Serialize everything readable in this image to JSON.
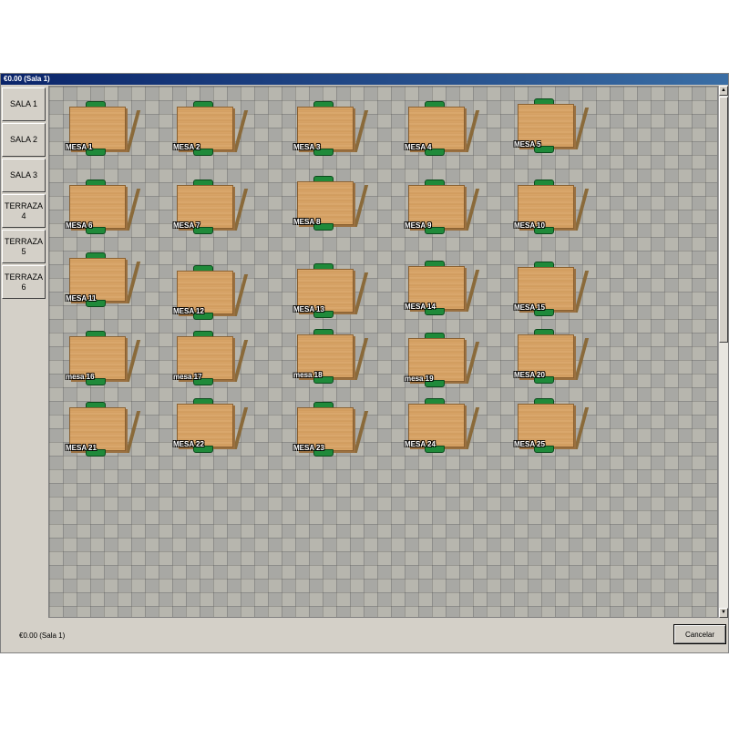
{
  "window": {
    "title": "€0.00 (Sala 1)"
  },
  "rooms": [
    {
      "label": "SALA 1"
    },
    {
      "label": "SALA 2"
    },
    {
      "label": "SALA 3"
    },
    {
      "label": "TERRAZA\n4"
    },
    {
      "label": "TERRAZA\n5"
    },
    {
      "label": "TERRAZA\n6"
    }
  ],
  "tables": [
    {
      "label": "MESA 1"
    },
    {
      "label": "MESA 2"
    },
    {
      "label": "MESA 3"
    },
    {
      "label": "MESA 4"
    },
    {
      "label": "MESA 5"
    },
    {
      "label": "MESA 6"
    },
    {
      "label": "MESA 7"
    },
    {
      "label": "MESA 8"
    },
    {
      "label": "MESA 9"
    },
    {
      "label": "MESA 10"
    },
    {
      "label": "MESA 11"
    },
    {
      "label": "MESA 12"
    },
    {
      "label": "MESA 13"
    },
    {
      "label": "MESA 14"
    },
    {
      "label": "MESA 15"
    },
    {
      "label": "mesa 16"
    },
    {
      "label": "mesa 17"
    },
    {
      "label": "mesa 18"
    },
    {
      "label": "mesa 19"
    },
    {
      "label": "MESA 20"
    },
    {
      "label": "MESA 21"
    },
    {
      "label": "MESA 22"
    },
    {
      "label": "MESA 23"
    },
    {
      "label": "MESA 24"
    },
    {
      "label": "MESA 25"
    }
  ],
  "footer": {
    "status": "€0.00 (Sala 1)",
    "cancel_label": "Cancelar"
  },
  "scrollbar": {
    "up_icon": "arrow-up-icon",
    "down_icon": "arrow-down-icon"
  }
}
